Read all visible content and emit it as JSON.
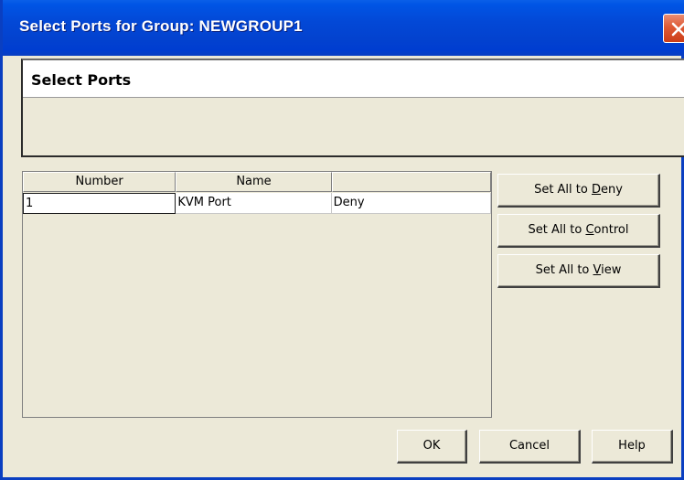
{
  "window": {
    "title": "Select Ports for Group: NEWGROUP1"
  },
  "panel": {
    "title": "Select Ports"
  },
  "table": {
    "columns": [
      "Number",
      "Name",
      ""
    ],
    "rows": [
      {
        "number": "1",
        "name": "KVM Port",
        "access": "Deny"
      }
    ]
  },
  "side_buttons": {
    "deny": {
      "prefix": "Set All to ",
      "mnemonic": "D",
      "suffix": "eny"
    },
    "control": {
      "prefix": "Set All to ",
      "mnemonic": "C",
      "suffix": "ontrol"
    },
    "view": {
      "prefix": "Set All to ",
      "mnemonic": "V",
      "suffix": "iew"
    }
  },
  "footer": {
    "ok_label": "OK",
    "cancel_label": "Cancel",
    "help_label": "Help"
  },
  "colors": {
    "titlebar": "#0348D6",
    "dialog_bg": "#ECE9D8",
    "close_button": "#DE5A35"
  },
  "icons": {
    "close": "close-icon"
  }
}
